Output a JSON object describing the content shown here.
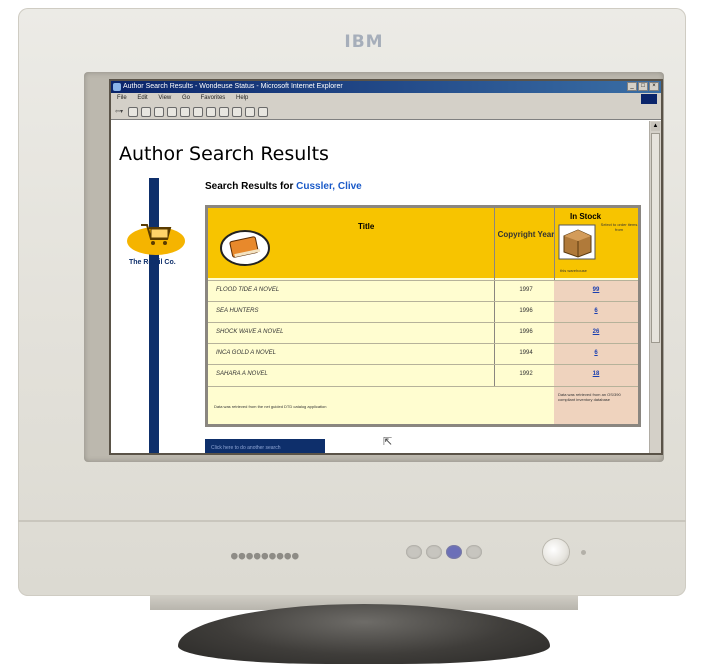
{
  "monitor": {
    "brand": "IBM",
    "status_dots": "●●●●●●●●●"
  },
  "browser": {
    "window_title": "Author Search Results - Wondeuse Status - Microsoft Internet Explorer",
    "menu": [
      "File",
      "Edit",
      "View",
      "Go",
      "Favorites",
      "Help"
    ],
    "back_label": "⇦▾",
    "win_buttons": [
      "_",
      "□",
      "×"
    ]
  },
  "page": {
    "title": "Author Search Results",
    "subtitle_prefix": "Search Results for ",
    "author": "Cussler, Clive",
    "logo_text": "The Retail Co.",
    "table": {
      "title_header": "Title",
      "year_header": "Copyright Year",
      "stock_header": "In Stock",
      "stock_note": "Select to order items from",
      "stock_caption": "this warehouse",
      "rows": [
        {
          "title": "FLOOD TIDE A NOVEL",
          "year": "1997",
          "stock": "99"
        },
        {
          "title": "SEA HUNTERS",
          "year": "1996",
          "stock": "6"
        },
        {
          "title": "SHOCK WAVE A NOVEL",
          "year": "1996",
          "stock": "26"
        },
        {
          "title": "INCA GOLD A NOVEL",
          "year": "1994",
          "stock": "6"
        },
        {
          "title": "SAHARA A NOVEL",
          "year": "1992",
          "stock": "18"
        }
      ],
      "footer_left": "Data was retrieved from the net guided DTD catalog application",
      "footer_right": "Data was retrieved from an OS/390 compliant inventory database"
    },
    "back_button_label": "Click here to do another search"
  },
  "colors": {
    "title_bar": "#0a246a",
    "table_header": "#f7c400",
    "table_rows": "#fffdd0",
    "stock_cells": "#efd3be",
    "link": "#1a3fb0",
    "side_bar": "#0e2f6b"
  }
}
